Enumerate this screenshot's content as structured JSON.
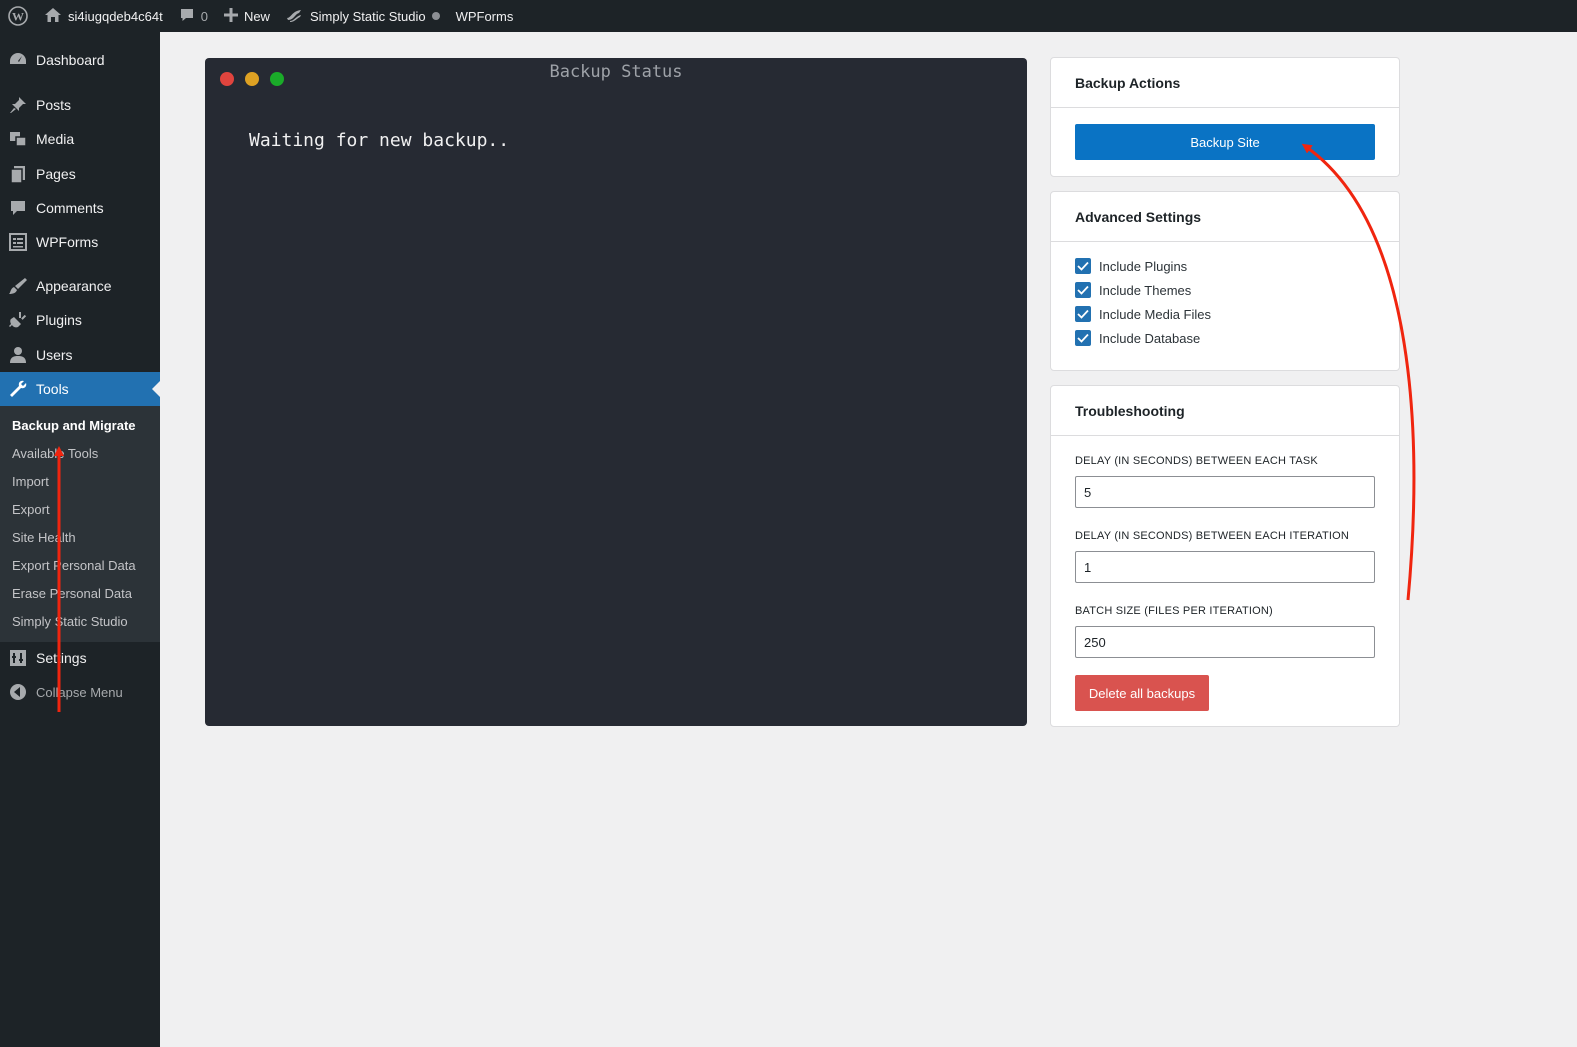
{
  "adminbar": {
    "site_name": "si4iugqdeb4c64t",
    "comments_count": "0",
    "new_label": "New",
    "simply_static_label": "Simply Static Studio",
    "wpforms_label": "WPForms"
  },
  "sidebar": {
    "items": [
      {
        "label": "Dashboard",
        "icon": "dashboard-icon"
      },
      {
        "label": "Posts",
        "icon": "pushpin-icon"
      },
      {
        "label": "Media",
        "icon": "media-icon"
      },
      {
        "label": "Pages",
        "icon": "pages-icon"
      },
      {
        "label": "Comments",
        "icon": "comment-icon"
      },
      {
        "label": "WPForms",
        "icon": "forms-icon"
      },
      {
        "label": "Appearance",
        "icon": "paintbrush-icon"
      },
      {
        "label": "Plugins",
        "icon": "plugin-icon"
      },
      {
        "label": "Users",
        "icon": "user-icon"
      },
      {
        "label": "Tools",
        "icon": "wrench-icon"
      },
      {
        "label": "Settings",
        "icon": "settings-icon"
      },
      {
        "label": "Collapse Menu",
        "icon": "collapse-icon"
      }
    ],
    "submenu": [
      "Backup and Migrate",
      "Available Tools",
      "Import",
      "Export",
      "Site Health",
      "Export Personal Data",
      "Erase Personal Data",
      "Simply Static Studio"
    ]
  },
  "terminal": {
    "title": "Backup Status",
    "text": "Waiting for new backup.."
  },
  "backup_actions": {
    "title": "Backup Actions",
    "button": "Backup Site"
  },
  "advanced_settings": {
    "title": "Advanced Settings",
    "options": [
      "Include Plugins",
      "Include Themes",
      "Include Media Files",
      "Include Database"
    ]
  },
  "troubleshooting": {
    "title": "Troubleshooting",
    "fields": [
      {
        "label": "DELAY (IN SECONDS) BETWEEN EACH TASK",
        "value": "5"
      },
      {
        "label": "DELAY (IN SECONDS) BETWEEN EACH ITERATION",
        "value": "1"
      },
      {
        "label": "BATCH SIZE (FILES PER ITERATION)",
        "value": "250"
      }
    ],
    "delete_button": "Delete all backups"
  },
  "colors": {
    "accent": "#2271b1",
    "primary_button": "#0a73c4",
    "danger_button": "#d9534f",
    "terminal_bg": "#262a33",
    "annotation_arrow": "#f0250f"
  }
}
